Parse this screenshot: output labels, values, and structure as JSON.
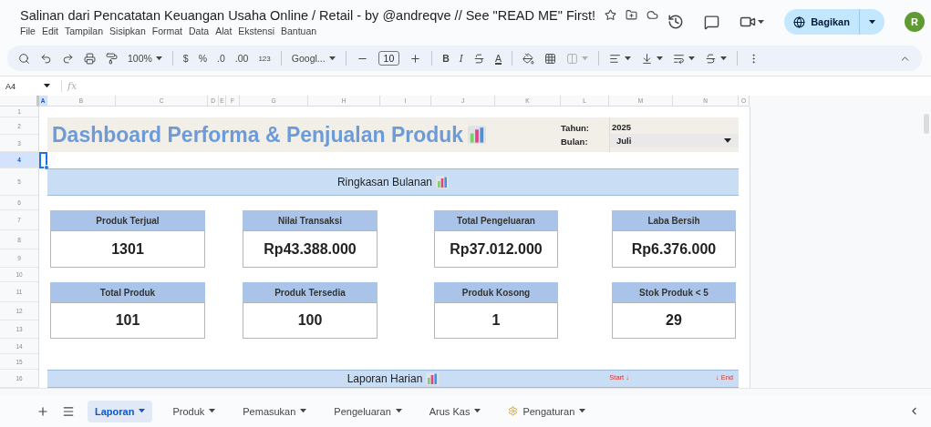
{
  "app": {
    "title": "Salinan dari Pencatatan Keuangan Usaha Online / Retail - by @andreqve // See \"READ ME\" First!",
    "menu": [
      "File",
      "Edit",
      "Tampilan",
      "Sisipkan",
      "Format",
      "Data",
      "Alat",
      "Ekstensi",
      "Bantuan"
    ],
    "share_button": "Bagikan",
    "avatar": "R"
  },
  "toolbar": {
    "zoom": "100%",
    "currency": "$",
    "percent": "%",
    "decrease_decimals": ".0",
    "increase_decimals": ".00",
    "number_format": "123",
    "font": "Googl...",
    "font_size": "10",
    "bold": "B",
    "italic": "I",
    "text_color": "A"
  },
  "formula_bar": {
    "cell_ref": "A4",
    "fx": "fx"
  },
  "columns": [
    {
      "label": "A",
      "selected": true
    },
    {
      "label": "B",
      "selected": false
    },
    {
      "label": "C",
      "selected": false
    },
    {
      "label": "D",
      "selected": false
    },
    {
      "label": "E",
      "selected": false
    },
    {
      "label": "F",
      "selected": false
    },
    {
      "label": "G",
      "selected": false
    },
    {
      "label": "H",
      "selected": false
    },
    {
      "label": "I",
      "selected": false
    },
    {
      "label": "J",
      "selected": false
    },
    {
      "label": "K",
      "selected": false
    },
    {
      "label": "L",
      "selected": false
    },
    {
      "label": "M",
      "selected": false
    },
    {
      "label": "N",
      "selected": false
    },
    {
      "label": "O",
      "selected": false
    }
  ],
  "rows": [
    {
      "label": "1",
      "selected": false
    },
    {
      "label": "2",
      "selected": false
    },
    {
      "label": "3",
      "selected": false
    },
    {
      "label": "4",
      "selected": true
    },
    {
      "label": "5",
      "selected": false
    },
    {
      "label": "6",
      "selected": false
    },
    {
      "label": "7",
      "selected": false
    },
    {
      "label": "8",
      "selected": false
    },
    {
      "label": "9",
      "selected": false
    },
    {
      "label": "10",
      "selected": false
    },
    {
      "label": "11",
      "selected": false
    },
    {
      "label": "12",
      "selected": false
    },
    {
      "label": "13",
      "selected": false
    },
    {
      "label": "14",
      "selected": false
    },
    {
      "label": "15",
      "selected": false
    },
    {
      "label": "16",
      "selected": false
    }
  ],
  "dashboard": {
    "title": "Dashboard Performa & Penjualan Produk",
    "year_label": "Tahun:",
    "year": "2025",
    "month_label": "Bulan:",
    "month": "Juli",
    "summary_title": "Ringkasan Bulanan",
    "cards": [
      {
        "label": "Produk Terjual",
        "value": "1301"
      },
      {
        "label": "Nilai Transaksi",
        "value": "Rp43.388.000"
      },
      {
        "label": "Total Pengeluaran",
        "value": "Rp37.012.000"
      },
      {
        "label": "Laba Bersih",
        "value": "Rp6.376.000"
      },
      {
        "label": "Total Produk",
        "value": "101"
      },
      {
        "label": "Produk Tersedia",
        "value": "100"
      },
      {
        "label": "Produk Kosong",
        "value": "1"
      },
      {
        "label": "Stok Produk < 5",
        "value": "29"
      }
    ],
    "daily_title": "Laporan Harian",
    "start_marker": "Start ↓",
    "end_marker": "↓ End"
  },
  "sheet_tabs": [
    {
      "label": "Laporan",
      "selected": true,
      "kind": "plain"
    },
    {
      "label": "Produk",
      "selected": false,
      "kind": "plain"
    },
    {
      "label": "Pemasukan",
      "selected": false,
      "kind": "plain"
    },
    {
      "label": "Pengeluaran",
      "selected": false,
      "kind": "plain"
    },
    {
      "label": "Arus Kas",
      "selected": false,
      "kind": "plain"
    },
    {
      "label": "Pengaturan",
      "selected": false,
      "kind": "settings"
    }
  ]
}
